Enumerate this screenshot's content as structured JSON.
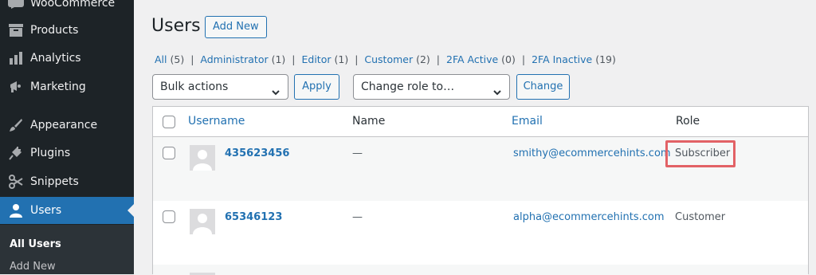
{
  "sidebar": {
    "items": [
      {
        "label": "WooCommerce",
        "icon": "woo-icon"
      },
      {
        "label": "Products",
        "icon": "archive-icon"
      },
      {
        "label": "Analytics",
        "icon": "chart-bar-icon"
      },
      {
        "label": "Marketing",
        "icon": "megaphone-icon"
      },
      {
        "label": "Appearance",
        "icon": "paintbrush-icon"
      },
      {
        "label": "Plugins",
        "icon": "plugin-icon"
      },
      {
        "label": "Snippets",
        "icon": "scissors-icon"
      },
      {
        "label": "Users",
        "icon": "user-icon"
      }
    ],
    "submenu": [
      {
        "label": "All Users"
      },
      {
        "label": "Add New"
      }
    ]
  },
  "page": {
    "title": "Users",
    "add_new": "Add New"
  },
  "filters": [
    {
      "label": "All",
      "count": "(5)"
    },
    {
      "label": "Administrator",
      "count": "(1)"
    },
    {
      "label": "Editor",
      "count": "(1)"
    },
    {
      "label": "Customer",
      "count": "(2)"
    },
    {
      "label": "2FA Active",
      "count": "(0)"
    },
    {
      "label": "2FA Inactive",
      "count": "(19)"
    }
  ],
  "filter_separator": "|",
  "toolbar": {
    "bulk_actions": "Bulk actions",
    "apply": "Apply",
    "change_role": "Change role to…",
    "change": "Change"
  },
  "table": {
    "headers": {
      "username": "Username",
      "name": "Name",
      "email": "Email",
      "role": "Role"
    },
    "rows": [
      {
        "username": "435623456",
        "name": "—",
        "email": "smithy@ecommercehints.com",
        "role": "Subscriber"
      },
      {
        "username": "65346123",
        "name": "—",
        "email": "alpha@ecommercehints.com",
        "role": "Customer"
      }
    ]
  },
  "colors": {
    "accent": "#2271b1",
    "sidebar_bg": "#1d2327",
    "highlight": "#e26266"
  }
}
